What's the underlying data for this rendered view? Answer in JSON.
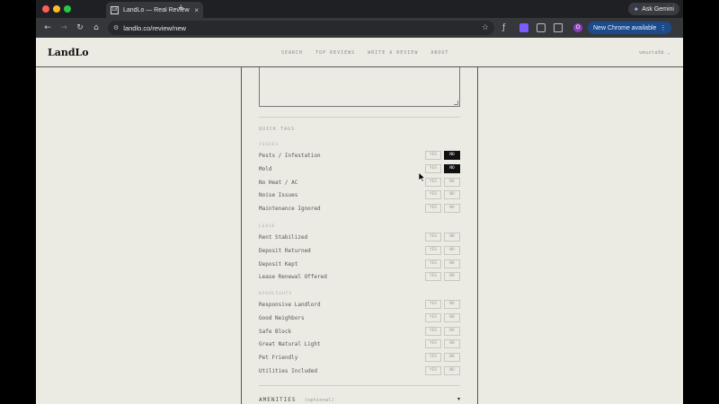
{
  "browser": {
    "tab_title": "LandLo — Real Reviews from",
    "tab_favicon": "Ld",
    "new_tab": "+",
    "gemini_label": "Ask Gemini",
    "url": "landlo.co/review/new",
    "profile_initial": "O",
    "update_label": "New Chrome available"
  },
  "site": {
    "logo": "LandLo",
    "nav": [
      "SEARCH",
      "TOP REVIEWS",
      "WRITE A REVIEW",
      "ABOUT"
    ],
    "user": "vmuzta9b ⌄"
  },
  "form": {
    "quick_tags_title": "QUICK TAGS",
    "yes_label": "YES",
    "no_label": "NO",
    "groups": [
      {
        "label": "ISSUES",
        "items": [
          {
            "label": "Pests / Infestation",
            "selected": "no"
          },
          {
            "label": "Mold",
            "selected": "no"
          },
          {
            "label": "No Heat / AC",
            "selected": null
          },
          {
            "label": "Noise Issues",
            "selected": null
          },
          {
            "label": "Maintenance Ignored",
            "selected": null
          }
        ]
      },
      {
        "label": "LEASE",
        "items": [
          {
            "label": "Rent Stabilized",
            "selected": null
          },
          {
            "label": "Deposit Returned",
            "selected": null
          },
          {
            "label": "Deposit Kept",
            "selected": null
          },
          {
            "label": "Lease Renewal Offered",
            "selected": null
          }
        ]
      },
      {
        "label": "HIGHLIGHTS",
        "items": [
          {
            "label": "Responsive Landlord",
            "selected": null
          },
          {
            "label": "Good Neighbors",
            "selected": null
          },
          {
            "label": "Safe Block",
            "selected": null
          },
          {
            "label": "Great Natural Light",
            "selected": null
          },
          {
            "label": "Pet Friendly",
            "selected": null
          },
          {
            "label": "Utilities Included",
            "selected": null
          }
        ]
      }
    ],
    "amenities_label": "AMENITIES",
    "amenities_optional": "(optional)",
    "amenities_caret": "▾"
  }
}
